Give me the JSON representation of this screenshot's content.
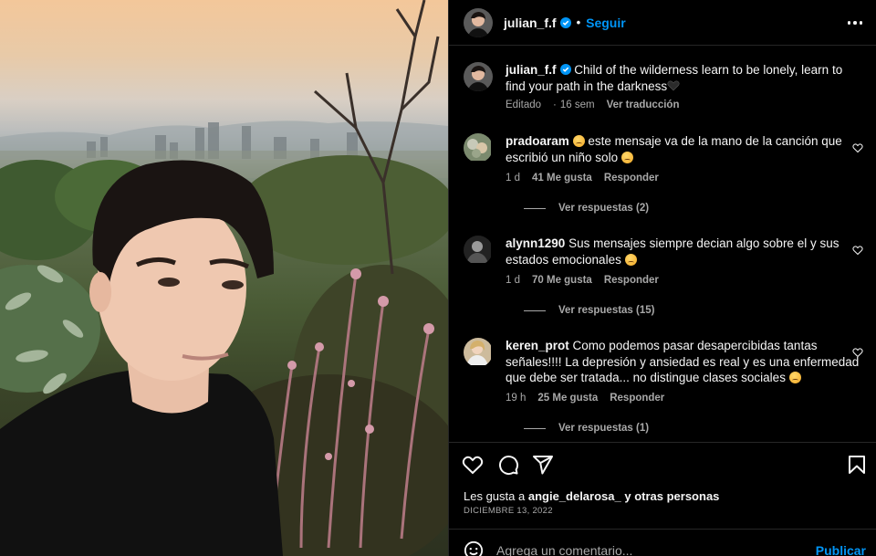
{
  "colors": {
    "accent": "#0095f6",
    "background": "#000000",
    "secondary_text": "#a8a8a8",
    "divider": "#262626"
  },
  "post": {
    "author": "julian_f.f",
    "follow_label": "Seguir",
    "caption": "Child of the wilderness learn to be lonely, learn to find your path in the darkness",
    "caption_emoji": "black-heart-icon",
    "edited_label": "Editado",
    "age": "16 sem",
    "translate_label": "Ver traducción"
  },
  "comments": [
    {
      "user": "pradoaram",
      "text": "este mensaje va de la mano de la canción que escribió un niño solo",
      "emojis": [
        "sad-face-emoji",
        "sad-face-emoji"
      ],
      "age": "1 d",
      "likes": "41 Me gusta",
      "reply_label": "Responder",
      "replies_label": "Ver respuestas (2)"
    },
    {
      "user": "alynn1290",
      "text": "Sus mensajes siempre decian algo sobre el y sus estados emocionales",
      "emojis": [
        "sad-face-emoji"
      ],
      "age": "1 d",
      "likes": "70 Me gusta",
      "reply_label": "Responder",
      "replies_label": "Ver respuestas (15)"
    },
    {
      "user": "keren_prot",
      "text": "Como podemos pasar desapercibidas tantas señales!!!! La depresión y ansiedad es real y es una enfermedad que debe ser tratada... no distingue clases sociales",
      "emojis": [
        "sad-face-emoji"
      ],
      "age": "19 h",
      "likes": "25 Me gusta",
      "reply_label": "Responder",
      "replies_label": "Ver respuestas (1)"
    }
  ],
  "actions": {
    "icons": [
      "heart-icon",
      "comment-icon",
      "share-icon",
      "bookmark-icon"
    ]
  },
  "likes": {
    "prefix": "Les gusta a",
    "user": "angie_delarosa_",
    "suffix": "y otras personas"
  },
  "date": "DICIEMBRE 13, 2022",
  "add_comment": {
    "placeholder": "Agrega un comentario...",
    "publish_label": "Publicar"
  }
}
